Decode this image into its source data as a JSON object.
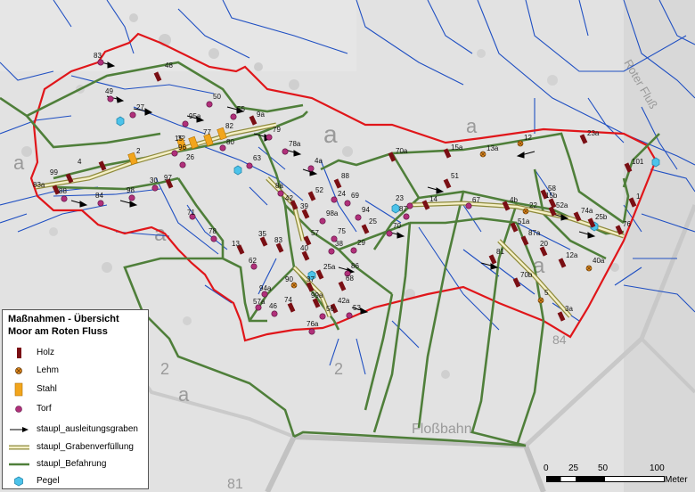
{
  "legend": {
    "title_line1": "Maßnahmen - Übersicht",
    "title_line2": "Moor am Roten Fluss",
    "items": [
      {
        "label": "Holz",
        "symbol": "wood-dam",
        "color": "#7a0f14"
      },
      {
        "label": "Lehm",
        "symbol": "clay-dam",
        "color": "#e08a1e"
      },
      {
        "label": "Stahl",
        "symbol": "steel-dam",
        "color": "#f2a51c"
      },
      {
        "label": "Torf",
        "symbol": "peat-dam",
        "color": "#b0307a"
      },
      {
        "label": "staupl_ausleitungsgraben",
        "symbol": "arrow",
        "color": "#000000"
      },
      {
        "label": "staupl_Grabenverfüllung",
        "symbol": "double-line",
        "color": "#c9c27a"
      },
      {
        "label": "staupl_Befahrung",
        "symbol": "green-line",
        "color": "#4f7f3a"
      },
      {
        "label": "Pegel",
        "symbol": "hexagon",
        "color": "#4cc3ea"
      }
    ]
  },
  "scale": {
    "ticks": [
      "0",
      "25",
      "50",
      "100"
    ],
    "unit": "Meter"
  },
  "background_labels": {
    "river": "Roter Fluß",
    "stream": "Floßbahn",
    "letters": [
      "a",
      "a",
      "a",
      "a",
      "a",
      "a",
      "2",
      "2",
      "81",
      "84"
    ]
  },
  "colors": {
    "boundary": "#e0161a",
    "ditch": "#1f4fc2",
    "befahrung": "#4f7f3a",
    "grabenverfuellung": "#c9c27a",
    "background": "#e4e4e4"
  },
  "measures": [
    {
      "id": "83",
      "type": "torf"
    },
    {
      "id": "48",
      "type": "holz"
    },
    {
      "id": "49",
      "type": "torf"
    },
    {
      "id": "27",
      "type": "torf"
    },
    {
      "id": "50",
      "type": "torf"
    },
    {
      "id": "55",
      "type": "torf"
    },
    {
      "id": "9a",
      "type": "holz"
    },
    {
      "id": "95a",
      "type": "torf"
    },
    {
      "id": "82",
      "type": "stahl"
    },
    {
      "id": "32",
      "type": "stahl"
    },
    {
      "id": "15",
      "type": "stahl"
    },
    {
      "id": "77",
      "type": "stahl"
    },
    {
      "id": "80",
      "type": "torf"
    },
    {
      "id": "79",
      "type": "torf"
    },
    {
      "id": "78a",
      "type": "torf"
    },
    {
      "id": "2",
      "type": "stahl"
    },
    {
      "id": "4",
      "type": "holz"
    },
    {
      "id": "99",
      "type": "holz"
    },
    {
      "id": "83a",
      "type": "holz"
    },
    {
      "id": "88",
      "type": "torf"
    },
    {
      "id": "84",
      "type": "torf"
    },
    {
      "id": "98",
      "type": "torf"
    },
    {
      "id": "30",
      "type": "torf"
    },
    {
      "id": "96",
      "type": "torf"
    },
    {
      "id": "26",
      "type": "torf"
    },
    {
      "id": "97",
      "type": "holz"
    },
    {
      "id": "63",
      "type": "torf"
    },
    {
      "id": "4a",
      "type": "torf"
    },
    {
      "id": "88 ",
      "type": "holz"
    },
    {
      "id": "71",
      "type": "torf"
    },
    {
      "id": "78",
      "type": "torf"
    },
    {
      "id": "8a",
      "type": "torf"
    },
    {
      "id": "52",
      "type": "holz"
    },
    {
      "id": "24",
      "type": "torf"
    },
    {
      "id": "42",
      "type": "holz"
    },
    {
      "id": "39",
      "type": "holz"
    },
    {
      "id": "98a",
      "type": "torf"
    },
    {
      "id": "69",
      "type": "torf"
    },
    {
      "id": "94",
      "type": "torf"
    },
    {
      "id": "13",
      "type": "holz"
    },
    {
      "id": "35",
      "type": "holz"
    },
    {
      "id": "83 ",
      "type": "holz"
    },
    {
      "id": "57",
      "type": "holz"
    },
    {
      "id": "75",
      "type": "torf"
    },
    {
      "id": "25",
      "type": "holz"
    },
    {
      "id": "62",
      "type": "torf"
    },
    {
      "id": "40",
      "type": "holz"
    },
    {
      "id": "38",
      "type": "torf"
    },
    {
      "id": "29",
      "type": "torf"
    },
    {
      "id": "25a",
      "type": "holz"
    },
    {
      "id": "86",
      "type": "torf"
    },
    {
      "id": "68",
      "type": "holz"
    },
    {
      "id": "90",
      "type": "lehm"
    },
    {
      "id": "37",
      "type": "holz"
    },
    {
      "id": "94a",
      "type": "torf"
    },
    {
      "id": "57a",
      "type": "torf"
    },
    {
      "id": "46",
      "type": "torf"
    },
    {
      "id": "74",
      "type": "holz"
    },
    {
      "id": "99a",
      "type": "holz"
    },
    {
      "id": "42a",
      "type": "holz"
    },
    {
      "id": "56",
      "type": "torf"
    },
    {
      "id": "53",
      "type": "torf"
    },
    {
      "id": "76a",
      "type": "torf"
    },
    {
      "id": "70a",
      "type": "holz"
    },
    {
      "id": "15a",
      "type": "holz"
    },
    {
      "id": "13a",
      "type": "lehm"
    },
    {
      "id": "12",
      "type": "lehm"
    },
    {
      "id": "23a",
      "type": "holz"
    },
    {
      "id": "51",
      "type": "holz"
    },
    {
      "id": "23",
      "type": "torf"
    },
    {
      "id": "87",
      "type": "torf"
    },
    {
      "id": "14",
      "type": "holz"
    },
    {
      "id": "70",
      "type": "torf"
    },
    {
      "id": "67",
      "type": "torf"
    },
    {
      "id": "4b",
      "type": "holz"
    },
    {
      "id": "58",
      "type": "holz"
    },
    {
      "id": "15b",
      "type": "holz"
    },
    {
      "id": "22",
      "type": "lehm"
    },
    {
      "id": "52a",
      "type": "holz"
    },
    {
      "id": "74a",
      "type": "holz"
    },
    {
      "id": "25b",
      "type": "holz"
    },
    {
      "id": "51a",
      "type": "holz"
    },
    {
      "id": "87a",
      "type": "holz"
    },
    {
      "id": "20",
      "type": "holz"
    },
    {
      "id": "12a",
      "type": "holz"
    },
    {
      "id": "40a",
      "type": "lehm"
    },
    {
      "id": "81",
      "type": "holz"
    },
    {
      "id": "70b",
      "type": "holz"
    },
    {
      "id": "5",
      "type": "lehm"
    },
    {
      "id": "3a",
      "type": "holz"
    },
    {
      "id": "101",
      "type": "holz"
    },
    {
      "id": "1",
      "type": "holz"
    },
    {
      "id": "76",
      "type": "holz"
    },
    {
      "id": "10",
      "type": "holz"
    },
    {
      "id": "100",
      "type": "holz"
    }
  ]
}
